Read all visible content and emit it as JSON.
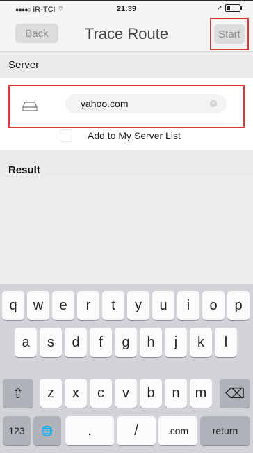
{
  "status_bar": {
    "carrier": "IR-TCI",
    "time": "21:39",
    "battery_level": 0.3
  },
  "nav": {
    "back_label": "Back",
    "title": "Trace Route",
    "start_label": "Start"
  },
  "server": {
    "header": "Server",
    "input_value": "yahoo.com",
    "add_to_list_label": "Add to My Server List"
  },
  "result": {
    "header": "Result"
  },
  "keyboard": {
    "row1": [
      "q",
      "w",
      "e",
      "r",
      "t",
      "y",
      "u",
      "i",
      "o",
      "p"
    ],
    "row2": [
      "a",
      "s",
      "d",
      "f",
      "g",
      "h",
      "j",
      "k",
      "l"
    ],
    "row3": [
      "z",
      "x",
      "c",
      "v",
      "b",
      "n",
      "m"
    ],
    "shift_glyph": "⇧",
    "delete_glyph": "⌫",
    "numbers_label": "123",
    "globe_glyph": "🌐",
    "dot_label": ".",
    "slash_label": "/",
    "dotcom_label": ".com",
    "return_label": "return"
  }
}
